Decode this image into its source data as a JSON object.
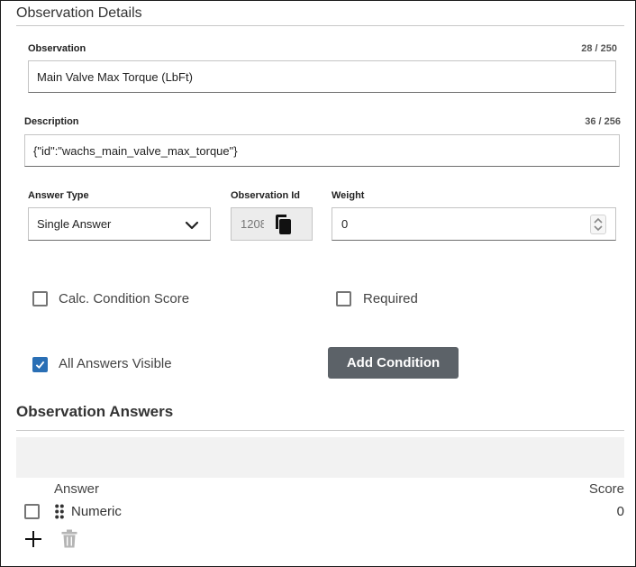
{
  "details": {
    "title": "Observation Details",
    "observation": {
      "label": "Observation",
      "counter": "28 / 250",
      "value": "Main Valve Max Torque (LbFt)"
    },
    "description": {
      "label": "Description",
      "counter": "36 / 256",
      "value": "{\"id\":\"wachs_main_valve_max_torque\"}"
    },
    "answer_type": {
      "label": "Answer Type",
      "selected": "Single Answer"
    },
    "observation_id": {
      "label": "Observation Id",
      "value": "1208"
    },
    "weight": {
      "label": "Weight",
      "value": "0"
    },
    "calc_condition_score": {
      "label": "Calc. Condition Score",
      "checked": false
    },
    "required": {
      "label": "Required",
      "checked": false
    },
    "all_answers_visible": {
      "label": "All Answers Visible",
      "checked": true
    },
    "add_condition_label": "Add Condition"
  },
  "answers": {
    "title": "Observation Answers",
    "columns": {
      "answer": "Answer",
      "score": "Score"
    },
    "rows": [
      {
        "answer": "Numeric",
        "score": "0",
        "selected": false
      }
    ]
  },
  "colors": {
    "accent": "#2a6fb5",
    "button": "#5c6268",
    "toolbar_bg": "#f2f2f2"
  }
}
